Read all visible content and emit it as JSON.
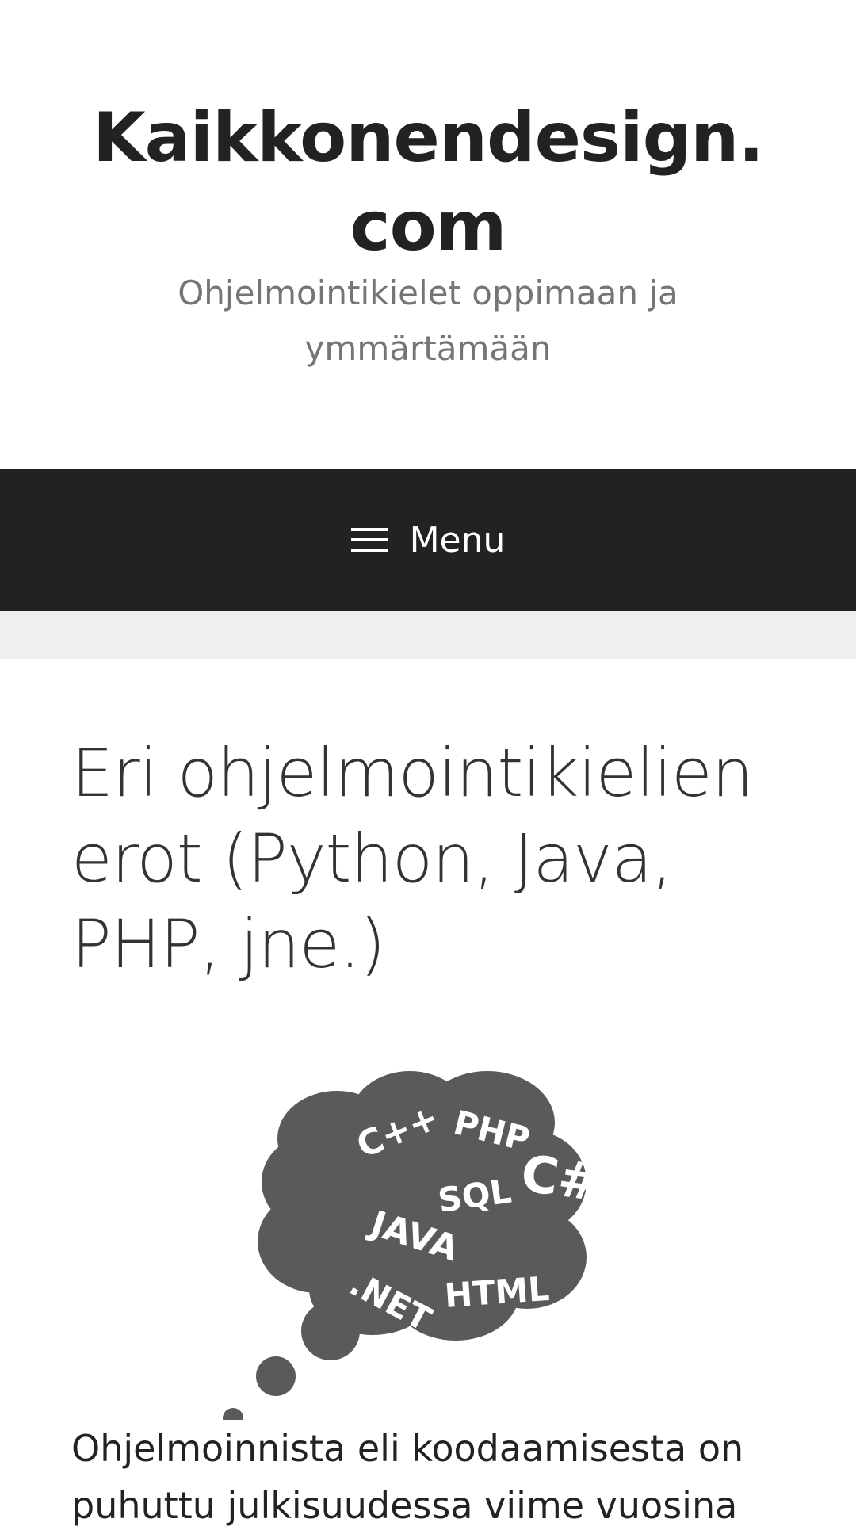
{
  "header": {
    "site_title": "Kaikkonendesign. com",
    "tagline": "Ohjelmointikielet oppimaan ja ymmärtämään"
  },
  "nav": {
    "menu_label": "Menu",
    "menu_icon": "hamburger-icon"
  },
  "post": {
    "title": "Eri ohjelmointikielien erot (Python, Java, PHP, jne.)",
    "image": {
      "labels": [
        "C++",
        "PHP",
        "C#",
        "SQL",
        "JAVA",
        ".NET",
        "HTML"
      ]
    },
    "intro_lines": [
      "Ohjelmoinnista eli koodaamisesta on",
      "puhuttu julkisuudessa viime vuosina"
    ]
  },
  "colors": {
    "nav_background": "#222222",
    "band_background": "#efefef",
    "cloud": "#5a5a5a",
    "tagline": "#757575"
  }
}
